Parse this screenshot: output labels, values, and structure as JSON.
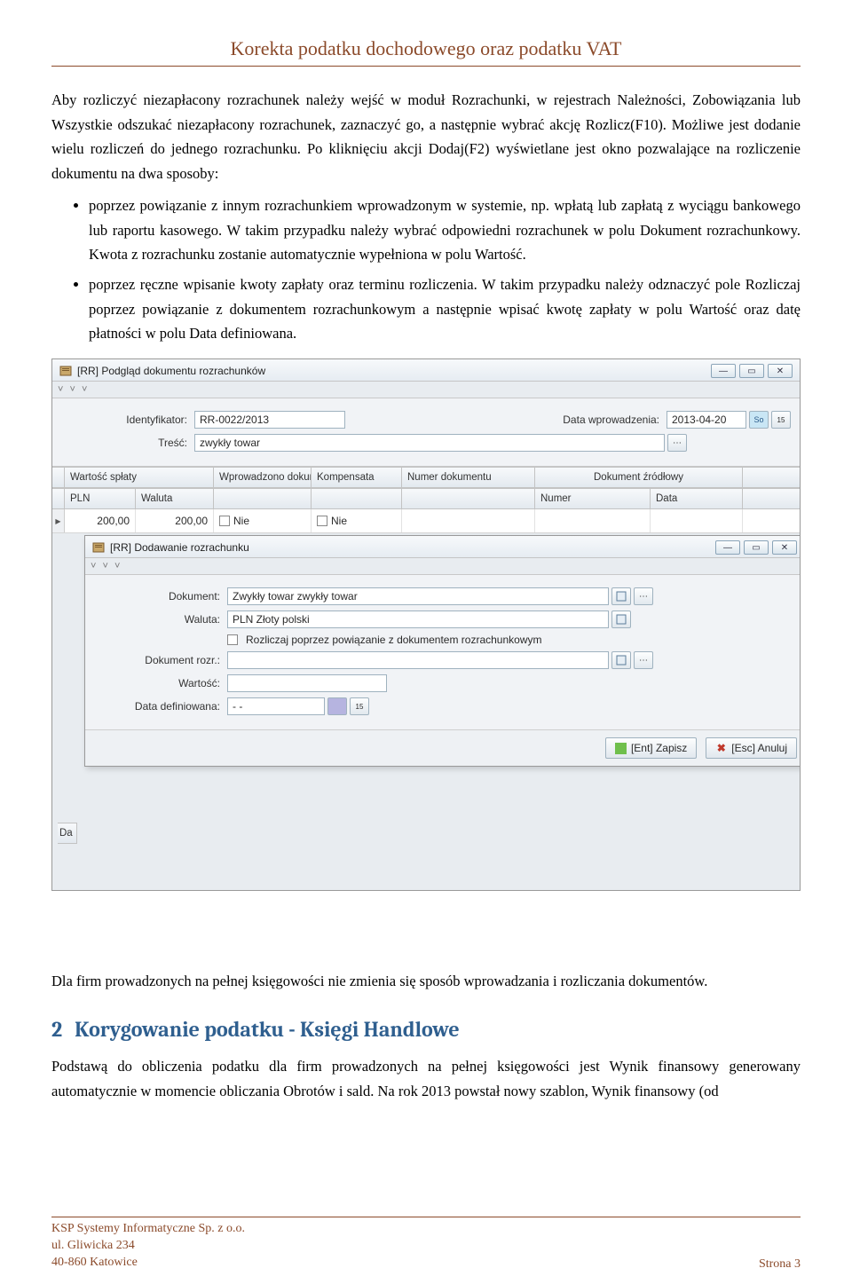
{
  "header": {
    "title": "Korekta podatku dochodowego oraz podatku VAT"
  },
  "para1": "Aby rozliczyć niezapłacony rozrachunek należy wejść w moduł Rozrachunki, w rejestrach Należności, Zobowiązania lub Wszystkie odszukać niezapłacony rozrachunek, zaznaczyć go, a następnie wybrać akcję Rozlicz(F10). Możliwe jest dodanie wielu rozliczeń do jednego rozrachunku. Po kliknięciu akcji Dodaj(F2) wyświetlane jest okno pozwalające na rozliczenie dokumentu na dwa sposoby:",
  "bullet1": "poprzez powiązanie z innym rozrachunkiem wprowadzonym w systemie, np. wpłatą lub zapłatą z wyciągu bankowego lub raportu kasowego. W takim przypadku należy wybrać odpowiedni rozrachunek w polu Dokument rozrachunkowy. Kwota z rozrachunku zostanie automatycznie wypełniona w polu Wartość.",
  "bullet2": "poprzez ręczne wpisanie kwoty zapłaty oraz terminu rozliczenia. W takim przypadku należy odznaczyć pole Rozliczaj poprzez powiązanie z dokumentem rozrachunkowym a następnie wpisać kwotę zapłaty w polu Wartość oraz datę płatności w polu Data definiowana.",
  "win1": {
    "title": "[RR] Podgląd dokumentu rozrachunków",
    "chev": "˅ ˅ ˅",
    "lbl_ident": "Identyfikator:",
    "val_ident": "RR-0022/2013",
    "lbl_data_wpr": "Data wprowadzenia:",
    "val_data_wpr": "2013-04-20",
    "day_badge": "So",
    "lbl_tresc": "Treść:",
    "val_tresc": "zwykły towar",
    "h_wsplaty": "Wartość spłaty",
    "h_wprow": "Wprowadzono dokument",
    "h_komp": "Kompensata",
    "h_numd": "Numer dokumentu",
    "h_dok": "Dokument źródłowy",
    "sh_pln": "PLN",
    "sh_wal": "Waluta",
    "sh_numer": "Numer",
    "sh_data": "Data",
    "row_pln": "200,00",
    "row_wal": "200,00",
    "row_nie": "Nie",
    "left_da": "Da"
  },
  "win2": {
    "title": "[RR] Dodawanie rozrachunku",
    "chev": "˅ ˅ ˅",
    "lbl_dokument": "Dokument:",
    "val_dokument": "Zwykły towar zwykły towar",
    "lbl_waluta": "Waluta:",
    "val_waluta": "PLN Złoty polski",
    "chk_label": "Rozliczaj poprzez powiązanie z dokumentem rozrachunkowym",
    "lbl_dok_rozr": "Dokument rozr.:",
    "lbl_wartosc": "Wartość:",
    "lbl_data_def": "Data definiowana:",
    "val_data_def": "- -",
    "btn_save": "[Ent] Zapisz",
    "btn_cancel": "[Esc] Anuluj"
  },
  "after": "Dla firm prowadzonych na pełnej księgowości nie zmienia się sposób wprowadzania i rozliczania dokumentów.",
  "section2": {
    "num": "2",
    "title": "Korygowanie podatku - Księgi Handlowe"
  },
  "para2": "Podstawą do obliczenia podatku dla firm prowadzonych na pełnej księgowości jest Wynik finansowy generowany automatycznie w momencie obliczania Obrotów i sald. Na rok 2013 powstał nowy szablon, Wynik finansowy (od",
  "footer": {
    "line1": "KSP Systemy Informatyczne Sp. z o.o.",
    "line2": "ul. Gliwicka 234",
    "line3": "40-860 Katowice",
    "page": "Strona 3"
  },
  "icons": {
    "dots": "⋯",
    "cal": "15"
  }
}
